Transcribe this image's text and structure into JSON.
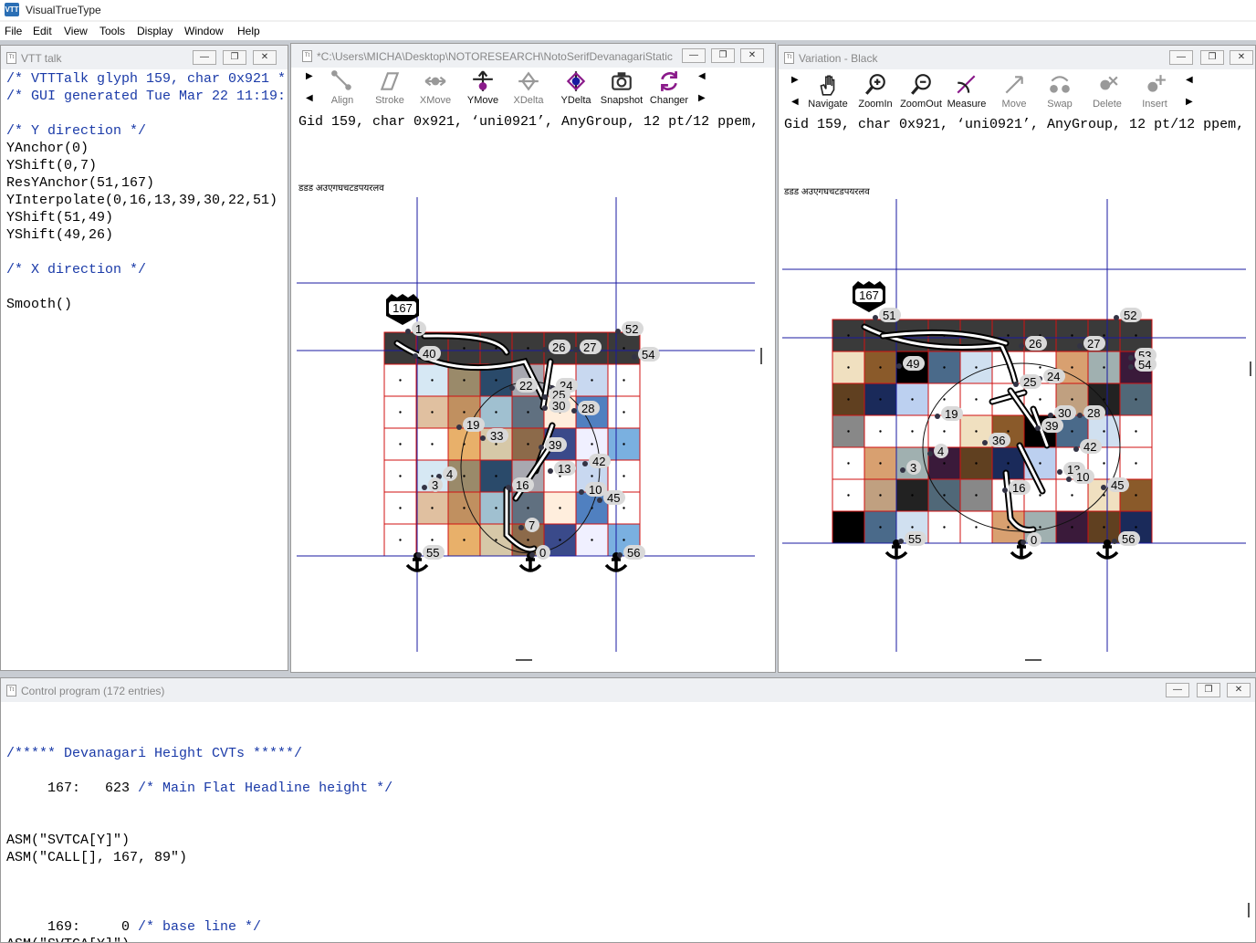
{
  "app": {
    "title": "VisualTrueType",
    "logo_text": "VTT"
  },
  "menu": [
    "File",
    "Edit",
    "View",
    "Tools",
    "Display",
    "Window",
    "Help"
  ],
  "talk_window": {
    "title": "VTT talk",
    "lines": [
      {
        "text": "/* VTTTalk glyph 159, char 0x921 *",
        "type": "comment"
      },
      {
        "text": "/* GUI generated Tue Mar 22 11:19:",
        "type": "comment"
      },
      {
        "text": "",
        "type": "code"
      },
      {
        "text": "/* Y direction */",
        "type": "comment"
      },
      {
        "text": "YAnchor(0)",
        "type": "code"
      },
      {
        "text": "YShift(0,7)",
        "type": "code"
      },
      {
        "text": "ResYAnchor(51,167)",
        "type": "code"
      },
      {
        "text": "YInterpolate(0,16,13,39,30,22,51)",
        "type": "code"
      },
      {
        "text": "YShift(51,49)",
        "type": "code"
      },
      {
        "text": "YShift(49,26)",
        "type": "code"
      },
      {
        "text": "",
        "type": "code"
      },
      {
        "text": "/* X direction */",
        "type": "comment"
      },
      {
        "text": "",
        "type": "code"
      },
      {
        "text": "Smooth()",
        "type": "code"
      }
    ]
  },
  "glyph_window": {
    "title": "*C:\\Users\\MICHA\\Desktop\\NOTORESEARCH\\NotoSerifDevanagariStatic...",
    "tools": [
      {
        "label": "Align",
        "icon": "align-icon",
        "active": false
      },
      {
        "label": "Stroke",
        "icon": "stroke-icon",
        "active": false
      },
      {
        "label": "XMove",
        "icon": "xmove-icon",
        "active": false
      },
      {
        "label": "YMove",
        "icon": "ymove-icon",
        "active": true
      },
      {
        "label": "XDelta",
        "icon": "xdelta-icon",
        "active": false
      },
      {
        "label": "YDelta",
        "icon": "ydelta-icon",
        "active": true
      },
      {
        "label": "Snapshot",
        "icon": "camera-icon",
        "active": true
      },
      {
        "label": "Changer",
        "icon": "changer-icon",
        "active": true
      }
    ],
    "status": "Gid 159, char 0x921, ‘uni0921’, AnyGroup, 12 pt/12 ppem,",
    "sample_text": "डडड  अउएगघचटडपयरलव",
    "cvt_label": "167",
    "point_labels": [
      "1",
      "40",
      "26",
      "27",
      "52",
      "54",
      "22",
      "24",
      "25",
      "30",
      "28",
      "19",
      "33",
      "39",
      "42",
      "4",
      "3",
      "16",
      "13",
      "10",
      "45",
      "7",
      "0",
      "55",
      "56"
    ]
  },
  "variation_window": {
    "title": "Variation - Black",
    "tools": [
      {
        "label": "Navigate",
        "icon": "hand-icon",
        "active": true
      },
      {
        "label": "ZoomIn",
        "icon": "zoom-in-icon",
        "active": true
      },
      {
        "label": "ZoomOut",
        "icon": "zoom-out-icon",
        "active": true
      },
      {
        "label": "Measure",
        "icon": "measure-icon",
        "active": true
      },
      {
        "label": "Move",
        "icon": "move-icon",
        "active": false
      },
      {
        "label": "Swap",
        "icon": "swap-icon",
        "active": false
      },
      {
        "label": "Delete",
        "icon": "delete-icon",
        "active": false
      },
      {
        "label": "Insert",
        "icon": "insert-icon",
        "active": false
      }
    ],
    "status": "Gid 159, char 0x921, ‘uni0921’, AnyGroup, 12 pt/12 ppem,",
    "sample_text": "डडड  अउएगघचटडपयरलव",
    "cvt_label": "167",
    "point_labels": [
      "51",
      "52",
      "49",
      "26",
      "27",
      "24",
      "25",
      "53",
      "54",
      "19",
      "30",
      "28",
      "4",
      "36",
      "39",
      "42",
      "3",
      "13",
      "10",
      "45",
      "16",
      "0",
      "55",
      "56"
    ]
  },
  "control_program": {
    "title": "Control program (172 entries)",
    "lines": [
      {
        "text": "",
        "type": "code"
      },
      {
        "text": "",
        "type": "code"
      },
      {
        "text": "/***** Devanagari Height CVTs *****/",
        "type": "comment"
      },
      {
        "text": "",
        "type": "code"
      },
      {
        "text": "     167:   623 ",
        "comment": "/* Main Flat Headline height */",
        "type": "mixed"
      },
      {
        "text": "",
        "type": "code"
      },
      {
        "text": "",
        "type": "code"
      },
      {
        "text": "ASM(\"SVTCA[Y]\")",
        "type": "code"
      },
      {
        "text": "ASM(\"CALL[], 167, 89\")",
        "type": "code"
      },
      {
        "text": "",
        "type": "code"
      },
      {
        "text": "",
        "type": "code"
      },
      {
        "text": "",
        "type": "code"
      },
      {
        "text": "     169:     0 ",
        "comment": "/* base line */",
        "type": "mixed"
      },
      {
        "text": "ASM(\"SVTCA[Y]\")",
        "type": "code"
      }
    ]
  },
  "colors": {
    "grid_red": "#d11111",
    "guide_blue": "#1a1aa0",
    "comment_blue": "#1a3aa8",
    "accent_purple": "#8a1a8a"
  }
}
